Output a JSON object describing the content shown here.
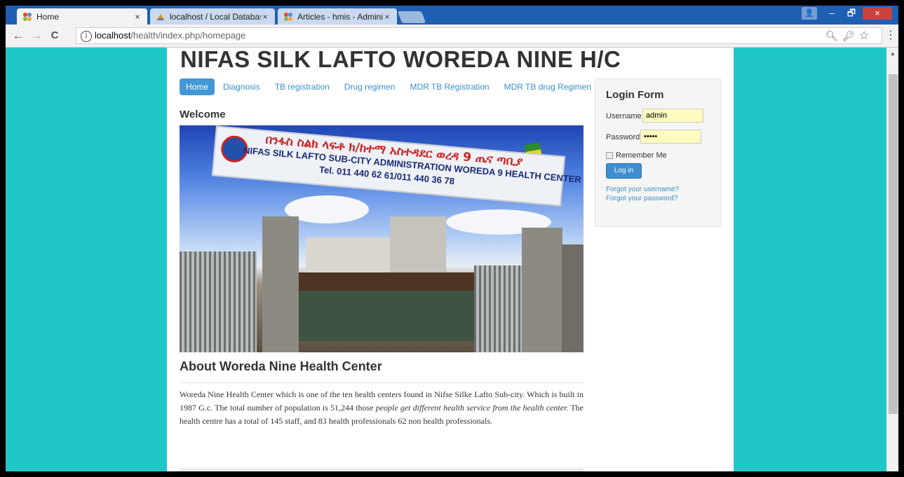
{
  "browser": {
    "tabs": [
      {
        "title": "Home",
        "active": true
      },
      {
        "title": "localhost / Local Databas",
        "active": false
      },
      {
        "title": "Articles - hmis - Adminis",
        "active": false
      }
    ],
    "close_glyph": "×",
    "window_controls": {
      "user": "👤",
      "minimize": "–",
      "restore": "🗗",
      "close": "×"
    },
    "nav": {
      "back": "←",
      "forward": "→",
      "reload": "C"
    },
    "url_host": "localhost",
    "url_path": "/health/index.php/homepage",
    "info_glyph": "i",
    "omnibox_icons": {
      "zoom": "🔍︎",
      "key": "🔑︎",
      "star": "☆",
      "menu": "⋮"
    }
  },
  "site": {
    "title": "NIFAS SILK LAFTO WOREDA NINE H/C",
    "nav": [
      "Home",
      "Diagnosis",
      "TB registration",
      "Drug regimen",
      "MDR TB Registration",
      "MDR TB drug Regimen"
    ],
    "welcome": "Welcome",
    "photo_sign": {
      "line1": "በንፋስ ስልክ ላፍቶ ክ/ከተማ አስተዳደር ወረዳ 9 ጤና ጣቢያ",
      "line2": "NIFAS SILK LAFTO SUB-CITY ADMINISTRATION WOREDA 9 HEALTH CENTER",
      "line3": "Tel. 011 440 62 61/011 440 36 78"
    },
    "about_heading": "About Woreda Nine Health Center",
    "about_p1": "Woreda Nine Health Center which is one of the ten health centers found in Nifse Silke Lafto Sub-city. Which is built in 1987 G.c. The total number of population is 51,244 those ",
    "about_em": "people get different health service from the health center.",
    "about_p2": " The health centre has a total of 145 staff, and 83 health professionals 62 non health professionals."
  },
  "login": {
    "title": "Login Form",
    "username_label": "Username",
    "username_value": "admin",
    "password_label": "Password",
    "password_value": "•••••",
    "remember_label": "Remember Me",
    "button": "Log in",
    "forgot_username": "Forgot your username?",
    "forgot_password": "Forgot your password?"
  },
  "colors": {
    "page_bg": "#20c7c8",
    "link": "#3a8fc8",
    "button": "#3f8fd0",
    "chrome": "#1f5fb3"
  }
}
